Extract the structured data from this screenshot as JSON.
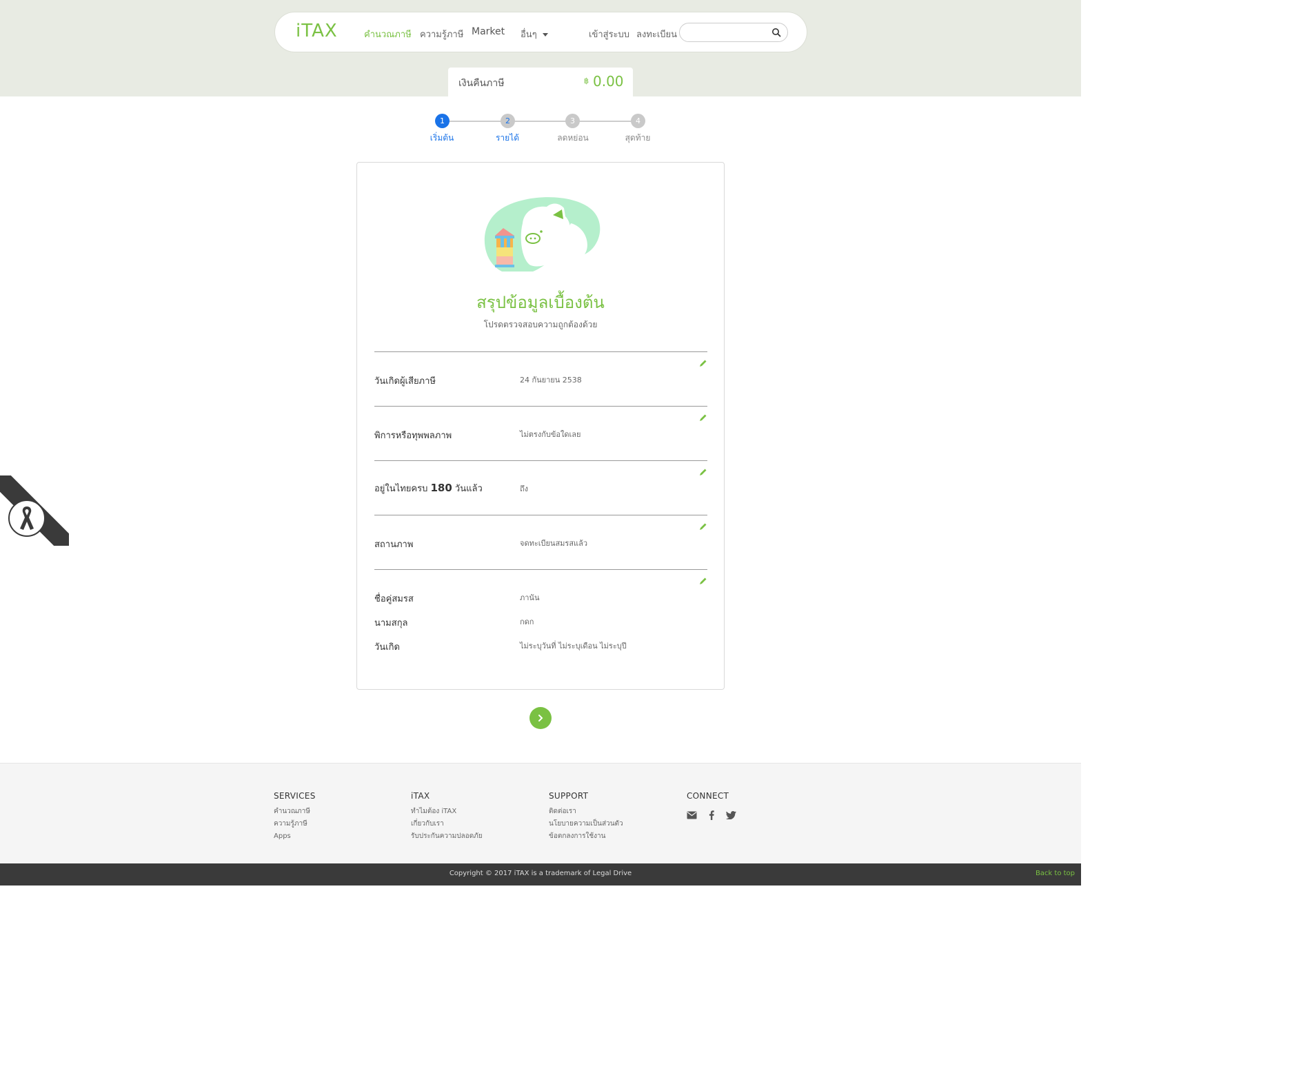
{
  "nav": {
    "logo": "iTAX",
    "items": [
      "คำนวณภาษี",
      "ความรู้ภาษี",
      "Market",
      "อื่นๆ"
    ],
    "login": "เข้าสู่ระบบ",
    "register": "ลงทะเบียน",
    "search_placeholder": ""
  },
  "refund": {
    "label": "เงินคืนภาษี",
    "currency": "฿",
    "value": "0.00"
  },
  "steps": [
    {
      "num": "1",
      "label": "เริ่มต้น",
      "state": "active"
    },
    {
      "num": "2",
      "label": "รายได้",
      "state": "next"
    },
    {
      "num": "3",
      "label": "ลดหย่อน",
      "state": "pending"
    },
    {
      "num": "4",
      "label": "สุดท้าย",
      "state": "pending"
    }
  ],
  "summary": {
    "title": "สรุปข้อมูลเบื้องต้น",
    "subtitle": "โปรดตรวจสอบความถูกต้องด้วย",
    "rows": [
      {
        "label": "วันเกิดผู้เสียภาษี",
        "value": "24 กันยายน 2538"
      },
      {
        "label": "พิการหรือทุพพลภาพ",
        "value": "ไม่ตรงกับข้อใดเลย"
      },
      {
        "label_pre": "อยู่ในไทยครบ",
        "label_num": "180",
        "label_post": "วันแล้ว",
        "value": "ถึง"
      },
      {
        "label": "สถานภาพ",
        "value": "จดทะเบียนสมรสแล้ว"
      },
      {
        "spouse_name_label": "ชื่อคู่สมรส",
        "spouse_name": "ภานัน",
        "spouse_surname_label": "นามสกุล",
        "spouse_surname": "กดก",
        "spouse_dob_label": "วันเกิด",
        "spouse_dob": "ไม่ระบุวันที่ ไม่ระบุเดือน ไม่ระบุปี"
      }
    ]
  },
  "footer": {
    "services": {
      "title": "SERVICES",
      "links": [
        "คำนวณภาษี",
        "ความรู้ภาษี",
        "Apps"
      ]
    },
    "itax": {
      "title": "iTAX",
      "links": [
        "ทำไมต้อง iTAX",
        "เกี่ยวกับเรา",
        "รับประกันความปลอดภัย"
      ]
    },
    "support": {
      "title": "SUPPORT",
      "links": [
        "ติดต่อเรา",
        "นโยบายความเป็นส่วนตัว",
        "ข้อตกลงการใช้งาน"
      ]
    },
    "connect": {
      "title": "CONNECT"
    },
    "copyright": "Copyright © 2017 iTAX is a trademark of Legal Drive",
    "back_to_top": "Back to top"
  },
  "colors": {
    "accent": "#7ac143",
    "step_active": "#1a73e8",
    "footer_bar": "#3a3a3a"
  },
  "icons": [
    "search-icon",
    "pencil-icon",
    "chevron-right-icon",
    "envelope-icon",
    "facebook-icon",
    "twitter-icon",
    "black-ribbon-icon"
  ]
}
